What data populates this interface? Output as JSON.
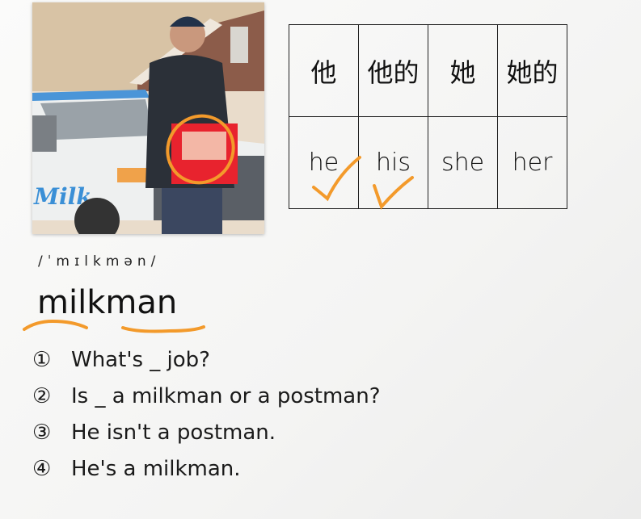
{
  "photo": {
    "description_icon": "milkman-photo",
    "van_logo_text": "Milk"
  },
  "table": {
    "chinese": [
      "他",
      "他的",
      "她",
      "她的"
    ],
    "english": [
      "he",
      "his",
      "she",
      "her"
    ],
    "checked": [
      true,
      true,
      false,
      false
    ]
  },
  "word": {
    "ipa": "/ˈmɪlkmən/",
    "text": "milkman"
  },
  "sentences": [
    {
      "num": "①",
      "text": "What's _ job?"
    },
    {
      "num": "②",
      "text": "Is _ a milkman or a postman?"
    },
    {
      "num": "③",
      "text": "He isn't a postman."
    },
    {
      "num": "④",
      "text": "He's a milkman."
    }
  ],
  "colors": {
    "annotation": "#f39a2b",
    "crate": "#e8232e",
    "van_blue": "#3a8fd6"
  }
}
